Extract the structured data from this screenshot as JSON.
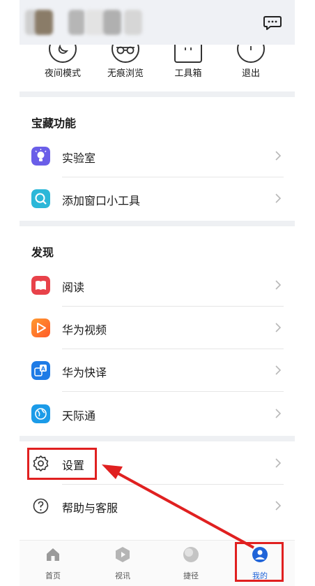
{
  "quick_actions": [
    {
      "label": "夜间模式",
      "icon": "moon-icon"
    },
    {
      "label": "无痕浏览",
      "icon": "glasses-icon"
    },
    {
      "label": "工具箱",
      "icon": "toolbox-icon"
    },
    {
      "label": "退出",
      "icon": "power-icon"
    }
  ],
  "sections": {
    "treasure": {
      "title": "宝藏功能",
      "items": [
        {
          "label": "实验室",
          "icon": "lab-bulb-icon"
        },
        {
          "label": "添加窗口小工具",
          "icon": "widget-search-icon"
        }
      ]
    },
    "discover": {
      "title": "发现",
      "items": [
        {
          "label": "阅读",
          "icon": "book-icon"
        },
        {
          "label": "华为视频",
          "icon": "video-play-icon"
        },
        {
          "label": "华为快译",
          "icon": "translate-icon"
        },
        {
          "label": "天际通",
          "icon": "globe-icon"
        }
      ]
    },
    "misc": {
      "items": [
        {
          "label": "设置",
          "icon": "gear-icon"
        },
        {
          "label": "帮助与客服",
          "icon": "help-icon"
        }
      ]
    }
  },
  "bottom_nav": [
    {
      "label": "首页",
      "icon": "home-icon"
    },
    {
      "label": "视讯",
      "icon": "video-hex-icon"
    },
    {
      "label": "捷径",
      "icon": "shortcut-icon"
    },
    {
      "label": "我的",
      "icon": "profile-icon",
      "active": true
    }
  ],
  "colors": {
    "accent": "#1f63d8",
    "annotation": "#e02020",
    "section_gap": "#eef0f3"
  }
}
